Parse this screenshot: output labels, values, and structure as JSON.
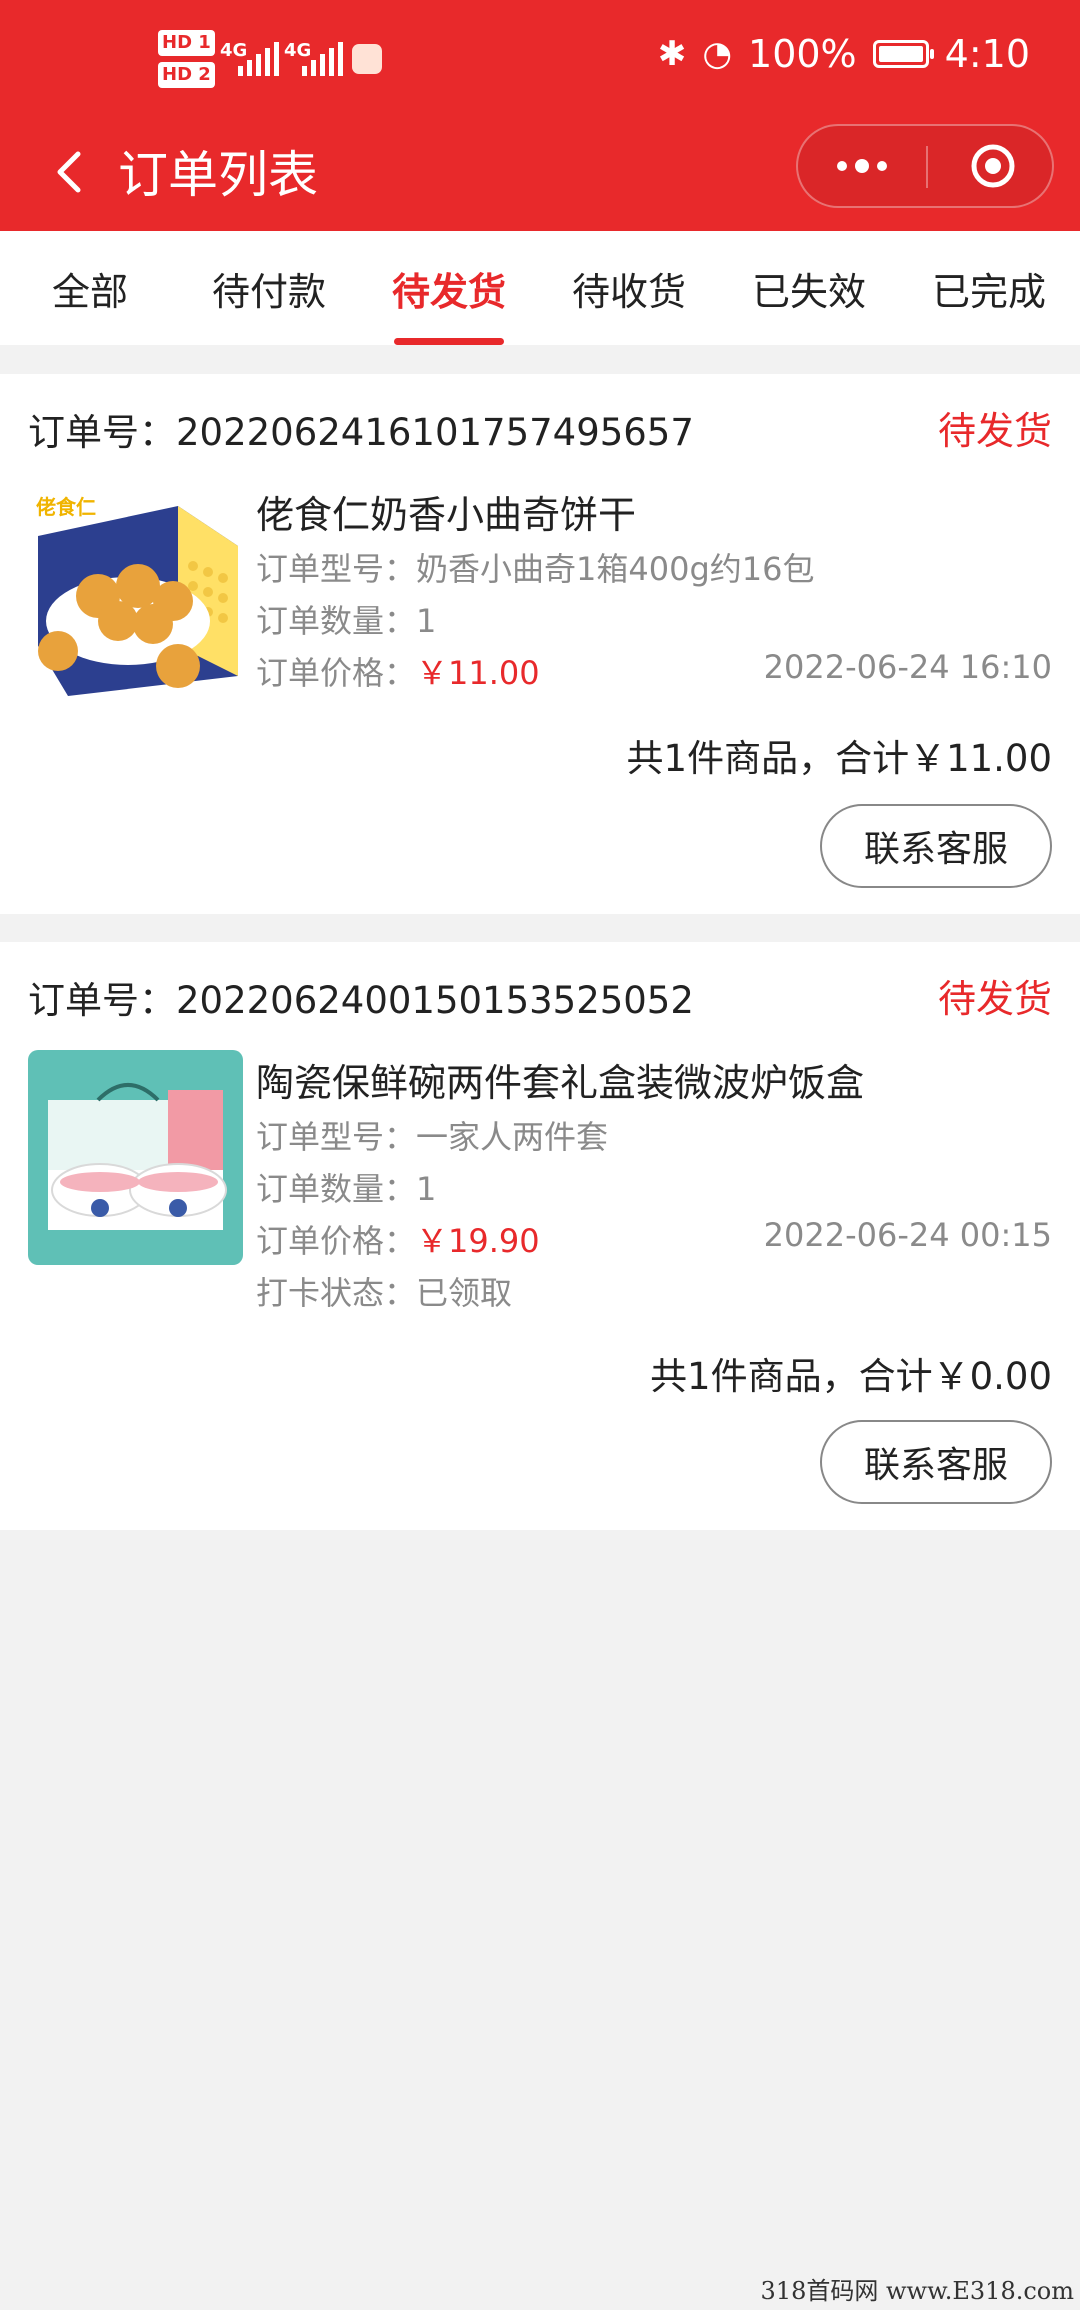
{
  "status_bar": {
    "sim1": "HD 1",
    "sim2": "HD 2",
    "net1": "4G",
    "net2": "4G",
    "battery": "100%",
    "time": "4:10",
    "battery_level": 1.0
  },
  "nav": {
    "title": "订单列表",
    "back_icon": "chevron-left-icon",
    "more_icon": "more-dots-icon",
    "close_icon": "target-circle-icon"
  },
  "tabs": [
    {
      "label": "全部",
      "active": false
    },
    {
      "label": "待付款",
      "active": false
    },
    {
      "label": "待发货",
      "active": true
    },
    {
      "label": "待收货",
      "active": false
    },
    {
      "label": "已失效",
      "active": false
    },
    {
      "label": "已完成",
      "active": false
    }
  ],
  "orders": [
    {
      "order_no_label": "订单号：",
      "order_no": "2022062416101757495657",
      "state": "待发货",
      "product_name": "佬食仁奶香小曲奇饼干",
      "model_label": "订单型号：",
      "model": "奶香小曲奇1箱400g约16包",
      "qty_label": "订单数量：",
      "qty": "1",
      "price_label": "订单价格：",
      "price": "￥11.00",
      "date": "2022-06-24 16:10",
      "total": "共1件商品，合计￥11.00",
      "button": "联系客服",
      "thumb_text": "佬食仁"
    },
    {
      "order_no_label": "订单号：",
      "order_no": "2022062400150153525052",
      "state": "待发货",
      "product_name": "陶瓷保鲜碗两件套礼盒装微波炉饭盒",
      "model_label": "订单型号：",
      "model": "一家人两件套",
      "qty_label": "订单数量：",
      "qty": "1",
      "price_label": "订单价格：",
      "price": "￥19.90",
      "date": "2022-06-24 00:15",
      "checkin_label": "打卡状态：",
      "checkin": "已领取",
      "total": "共1件商品，合计￥0.00",
      "button": "联系客服"
    }
  ],
  "watermark": "318首码网  www.E318.com",
  "colors": {
    "brand": "#e8292b",
    "background": "#f2f2f2",
    "muted_text": "#8a8a8a"
  }
}
